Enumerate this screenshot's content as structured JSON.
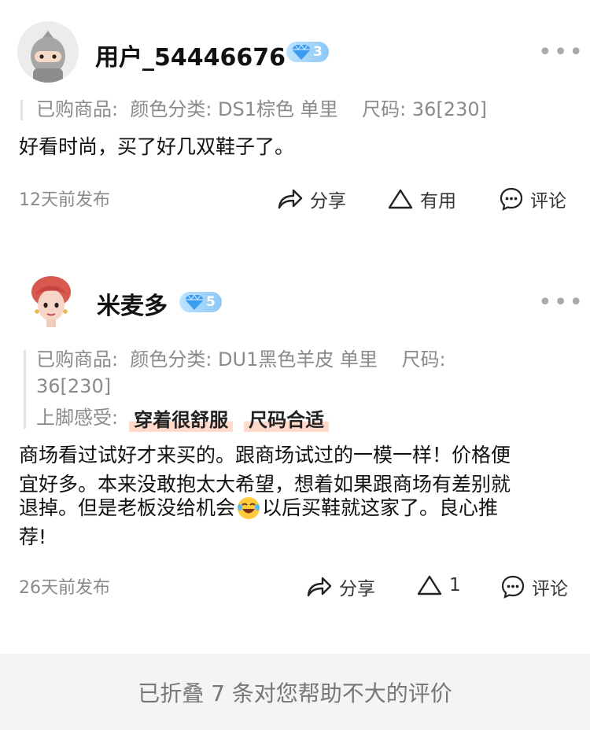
{
  "reviews": [
    {
      "username": "用户_54446676",
      "level": "3",
      "spec_text": "已购商品:  颜色分类: DS1棕色 单里    尺码: 36[230]",
      "content": "好看时尚，买了好几双鞋子了。",
      "time": "12天前发布",
      "share_label": "分享",
      "useful_label": "有用",
      "comment_label": "评论"
    },
    {
      "username": "米麦多",
      "level": "5",
      "spec_line1": "已购商品:  颜色分类: DU1黑色羊皮 单里    尺码:",
      "spec_line2": "36[230]",
      "feel_label": "上脚感受:",
      "tags": [
        "穿着很舒服",
        "尺码合适"
      ],
      "content_line1": "商场看过试好才来买的。跟商场试过的一模一样！价格便",
      "content_line2": "宜好多。本来没敢抱太大希望，想着如果跟商场有差别就",
      "content_line3_a": "退掉。但是老板没给机会",
      "content_line3_b": "以后买鞋就这家了。良心推",
      "content_line4": "荐!",
      "time": "26天前发布",
      "share_label": "分享",
      "useful_label": "1",
      "comment_label": "评论"
    }
  ],
  "footer_text": "已折叠 7 条对您帮助不大的评价",
  "more_glyph": "•••",
  "colors": {
    "badge": "#8cc8f7",
    "tag_highlight": "#ffd9c9",
    "footer_bg": "#f4f4f4"
  },
  "icons": [
    "ninja-avatar",
    "girl-avatar",
    "diamond-icon",
    "share-icon",
    "triangle-icon",
    "comment-icon",
    "laughing-emoji"
  ]
}
